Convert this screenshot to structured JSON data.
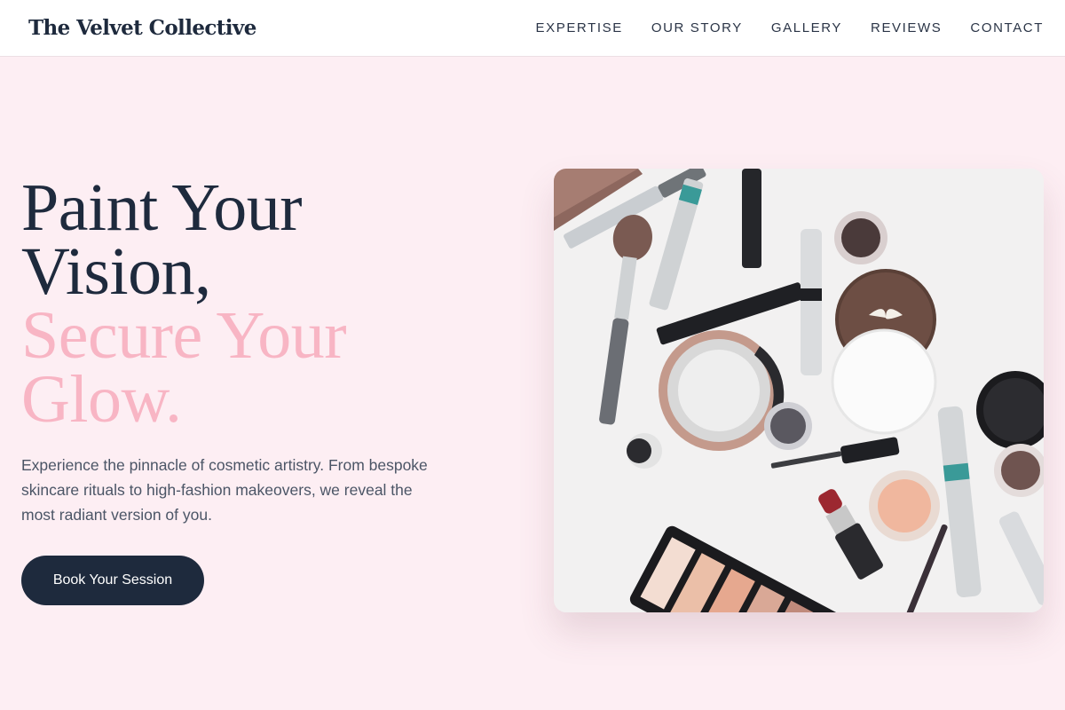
{
  "brand": {
    "name": "The Velvet Collective"
  },
  "nav": {
    "items": [
      {
        "label": "EXPERTISE"
      },
      {
        "label": "OUR STORY"
      },
      {
        "label": "GALLERY"
      },
      {
        "label": "REVIEWS"
      },
      {
        "label": "CONTACT"
      }
    ]
  },
  "hero": {
    "heading_lines": [
      "Paint Your",
      "Vision,",
      "Secure Your",
      "Glow."
    ],
    "description": "Experience the pinnacle of cosmetic artistry. From bespoke skincare rituals to high-fashion makeovers, we reveal the most radiant version of you.",
    "cta_label": "Book Your Session",
    "image_subject": "flat lay of makeup products: brushes, mascara, lipstick, eyeshadow palette, powder compacts"
  },
  "colors": {
    "page_bg": "#fdeef3",
    "navy": "#1e2a3d",
    "pink_accent": "#f8b5c4",
    "body_text": "#4b5566"
  }
}
